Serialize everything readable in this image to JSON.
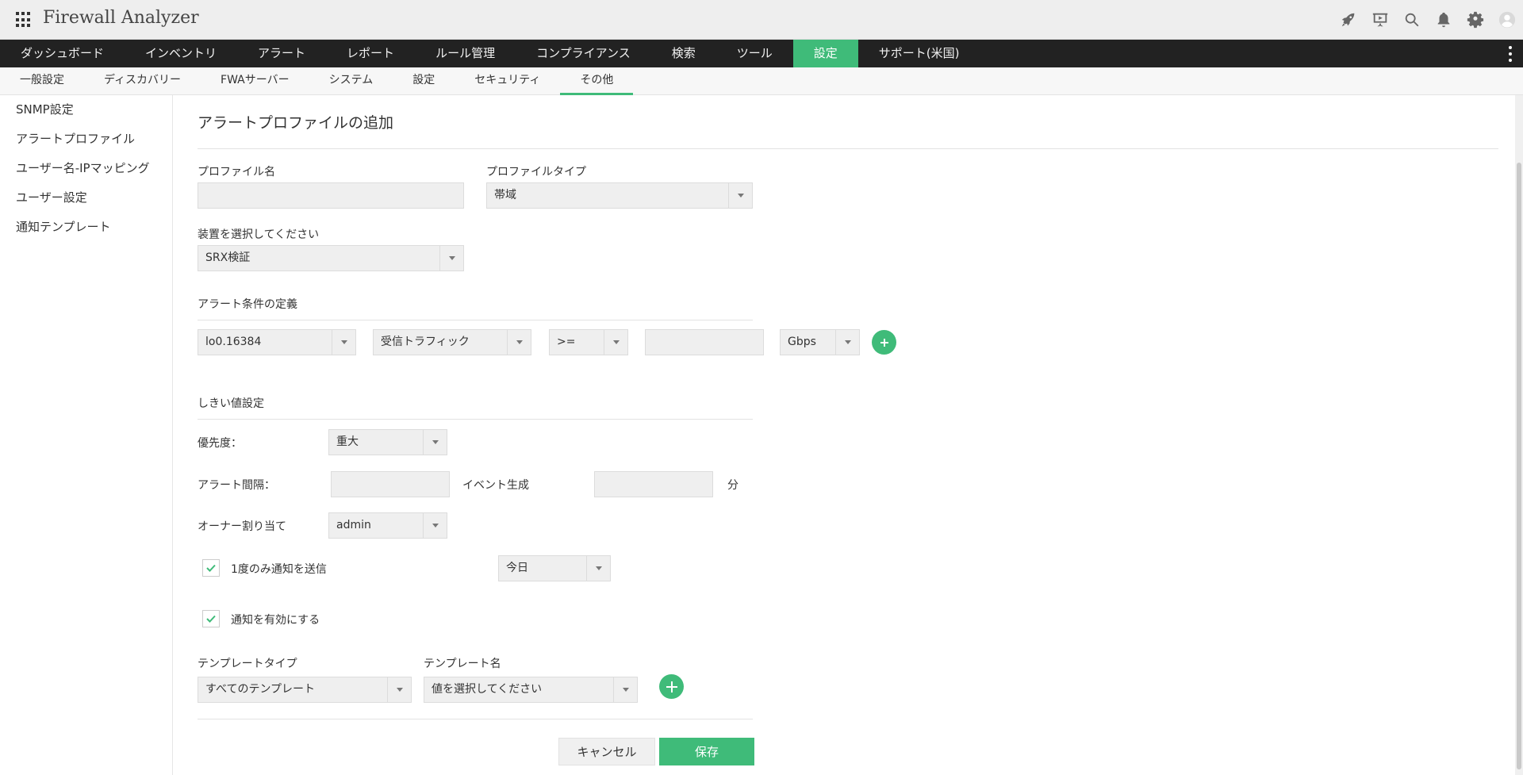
{
  "app": {
    "title": "Firewall Analyzer"
  },
  "top_icons": [
    "rocket-icon",
    "presentation-icon",
    "search-icon",
    "bell-icon",
    "gear-icon",
    "user-avatar-icon"
  ],
  "main_nav": [
    {
      "label": "ダッシュボード",
      "active": false
    },
    {
      "label": "インベントリ",
      "active": false
    },
    {
      "label": "アラート",
      "active": false
    },
    {
      "label": "レポート",
      "active": false
    },
    {
      "label": "ルール管理",
      "active": false
    },
    {
      "label": "コンプライアンス",
      "active": false
    },
    {
      "label": "検索",
      "active": false
    },
    {
      "label": "ツール",
      "active": false
    },
    {
      "label": "設定",
      "active": true
    },
    {
      "label": "サポート(米国)",
      "active": false
    }
  ],
  "sub_nav": [
    {
      "label": "一般設定",
      "active": false
    },
    {
      "label": "ディスカバリー",
      "active": false
    },
    {
      "label": "FWAサーバー",
      "active": false
    },
    {
      "label": "システム",
      "active": false
    },
    {
      "label": "設定",
      "active": false
    },
    {
      "label": "セキュリティ",
      "active": false
    },
    {
      "label": "その他",
      "active": true
    }
  ],
  "sidebar": [
    {
      "label": "SNMP設定"
    },
    {
      "label": "アラートプロファイル"
    },
    {
      "label": "ユーザー名-IPマッピング"
    },
    {
      "label": "ユーザー設定"
    },
    {
      "label": "通知テンプレート"
    }
  ],
  "form": {
    "title": "アラートプロファイルの追加",
    "profile_name": {
      "label": "プロファイル名",
      "value": ""
    },
    "profile_type": {
      "label": "プロファイルタイプ",
      "value": "帯域"
    },
    "device": {
      "label": "装置を選択してください",
      "value": "SRX検証"
    },
    "condition": {
      "title": "アラート条件の定義",
      "interface": "lo0.16384",
      "traffic": "受信トラフィック",
      "operator": ">=",
      "value": "",
      "unit": "Gbps"
    },
    "threshold": {
      "title": "しきい値設定",
      "priority_label": "優先度：",
      "priority": "重大",
      "interval_label": "アラート間隔：",
      "interval_value": "",
      "event_label": "イベント生成",
      "event_value": "",
      "minutes_label": "分",
      "owner_label": "オーナー割り当て",
      "owner": "admin",
      "send_once": {
        "label": "1度のみ通知を送信",
        "checked": true
      },
      "send_once_period": "今日",
      "enable_notify": {
        "label": "通知を有効にする",
        "checked": true
      }
    },
    "template": {
      "type_label": "テンプレートタイプ",
      "type_value": "すべてのテンプレート",
      "name_label": "テンプレート名",
      "name_value": "値を選択してください"
    },
    "buttons": {
      "cancel": "キャンセル",
      "save": "保存"
    }
  },
  "colors": {
    "accent": "#3fbb79",
    "nav_bg": "#222222",
    "top_bg": "#eeeeee"
  }
}
